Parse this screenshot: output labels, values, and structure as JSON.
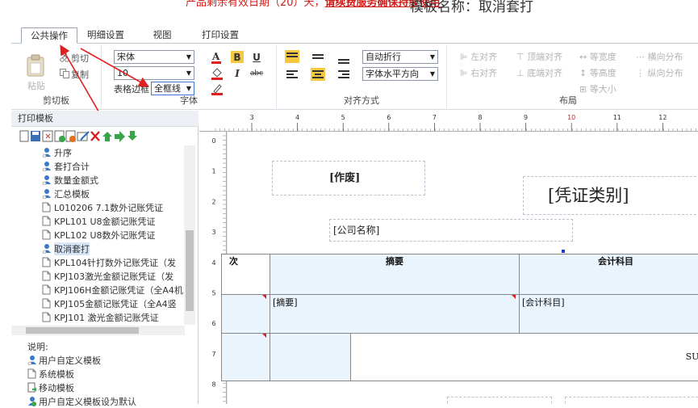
{
  "top": {
    "warning_prefix": "产品剩余有效日期（20）天，",
    "warning_link": "请续费服务确保持续使用",
    "template_name": "模板名称：取消套打"
  },
  "tabs": [
    {
      "label": "公共操作"
    },
    {
      "label": "明细设置"
    },
    {
      "label": "视图"
    },
    {
      "label": "打印设置"
    }
  ],
  "clipboard": {
    "paste": "粘贴",
    "cut": "剪切",
    "copy": "复制",
    "title": "剪切板"
  },
  "font": {
    "family": "宋体",
    "size": "10",
    "border_label": "表格边框",
    "border_value": "全框线",
    "title": "字体",
    "bold": "B",
    "italic": "I",
    "underline": "U",
    "strike": "abc"
  },
  "align": {
    "wrap": "自动折行",
    "direction": "字体水平方向",
    "title": "对齐方式"
  },
  "layout": {
    "left": "左对齐",
    "right": "右对齐",
    "top": "顶端对齐",
    "bottom": "底端对齐",
    "eqw": "等宽度",
    "eqh": "等高度",
    "eqs": "等大小",
    "hdist": "横向分布",
    "vdist": "纵向分布",
    "title": "布局"
  },
  "left": {
    "title": "打印模板",
    "tree": [
      {
        "label": "升序",
        "type": "user"
      },
      {
        "label": "套打合计",
        "type": "user"
      },
      {
        "label": "数量金额式",
        "type": "user"
      },
      {
        "label": "汇总模板",
        "type": "user"
      },
      {
        "label": "L010206 7.1数外记账凭证",
        "type": "system"
      },
      {
        "label": "KPL101 U8金额记账凭证",
        "type": "system"
      },
      {
        "label": "KPL102 U8数外记账凭证",
        "type": "system"
      },
      {
        "label": "取消套打",
        "type": "user",
        "selected": true
      },
      {
        "label": "KPL104针打数外记账凭证（发",
        "type": "system"
      },
      {
        "label": "KPJ103激光金额记账凭证（发",
        "type": "system"
      },
      {
        "label": "KPJ106H金额记账凭证（全A4机",
        "type": "system"
      },
      {
        "label": "KPJ105金额记账凭证（全A4竖",
        "type": "system"
      },
      {
        "label": "KPJ101 激光金额记账凭证",
        "type": "system"
      }
    ],
    "legend_title": "说明:",
    "legend": [
      {
        "label": "用户自定义模板",
        "type": "user"
      },
      {
        "label": "系统模板",
        "type": "system"
      },
      {
        "label": "移动模板",
        "type": "mobile"
      },
      {
        "label": "用户自定义模板设为默认",
        "type": "default"
      }
    ]
  },
  "ruler": {
    "h": [
      "3",
      "4",
      "5",
      "6",
      "7",
      "8",
      "9",
      "10",
      "11",
      "12",
      "13",
      "14",
      "15",
      "16",
      "17"
    ],
    "v": [
      "0",
      "1",
      "2",
      "3",
      "4",
      "5",
      "6",
      "7",
      "8"
    ]
  },
  "paper": {
    "void": "[作废]",
    "voucher_type": "[凭证类别]",
    "company": "[公司名称]",
    "col_seq": "次",
    "col_summary": "摘要",
    "col_account": "会计科目",
    "cell_summary": "[摘要]",
    "cell_account": "[会计科目]",
    "sum": "SUM("
  },
  "colors": {
    "accent": "#e02020",
    "cell_bg": "#e9f4fd",
    "highlight": "#f5c842"
  }
}
